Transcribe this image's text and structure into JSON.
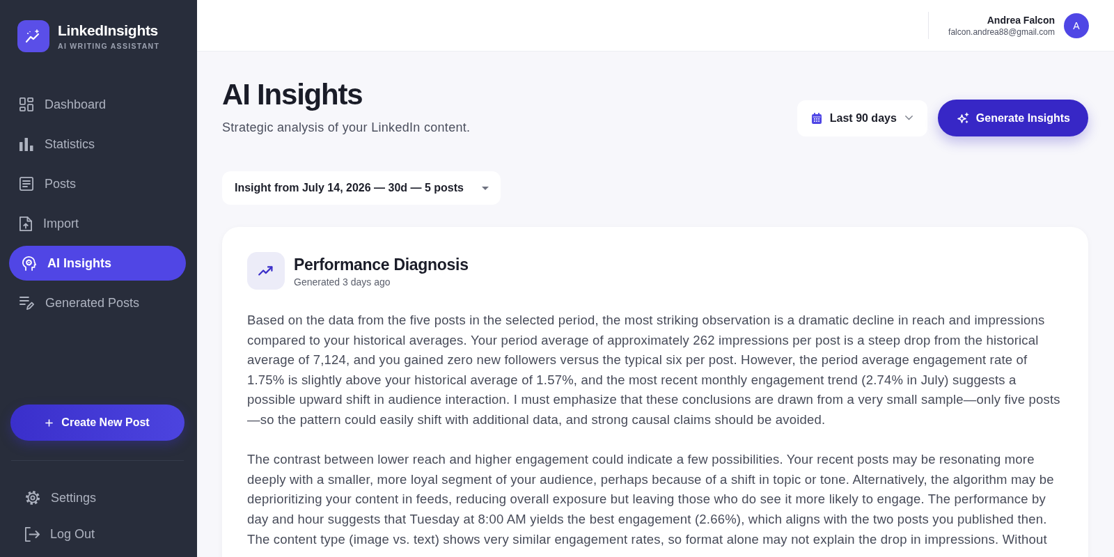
{
  "sidebar": {
    "brand": {
      "name": "LinkedInsights",
      "tagline": "AI WRITING ASSISTANT"
    },
    "nav": [
      {
        "label": "Dashboard",
        "kind": "dashboard",
        "selected": false
      },
      {
        "label": "Statistics",
        "kind": "statistics",
        "selected": false
      },
      {
        "label": "Posts",
        "kind": "posts",
        "selected": false
      },
      {
        "label": "Import",
        "kind": "import",
        "selected": false
      },
      {
        "label": "AI Insights",
        "kind": "insights",
        "selected": true
      },
      {
        "label": "Generated Posts",
        "kind": "generated",
        "selected": false
      }
    ],
    "create_button": "Create New Post",
    "footer_items": [
      {
        "label": "Settings",
        "kind": "settings"
      },
      {
        "label": "Log Out",
        "kind": "logout"
      }
    ]
  },
  "header": {
    "user": {
      "name": "Andrea Falcon",
      "email": "falcon.andrea88@gmail.com",
      "initial": "A"
    }
  },
  "page": {
    "title": "AI Insights",
    "subtitle": "Strategic analysis of your LinkedIn content.",
    "range_select": {
      "value": "Last 90 days"
    },
    "generate_button": "Generate Insights",
    "insight_select": {
      "value": "Insight from July 14, 2026 — 30d — 5 posts"
    }
  },
  "card": {
    "title": "Performance Diagnosis",
    "meta": "Generated 3 days ago",
    "paragraphs": [
      "Based on the data from the five posts in the selected period, the most striking observation is a dramatic decline in reach and impressions compared to your historical averages. Your period average of approximately 262 impressions per post is a steep drop from the historical average of 7,124, and you gained zero new followers versus the typical six per post. However, the period average engagement rate of 1.75% is slightly above your historical average of 1.57%, and the most recent monthly engagement trend (2.74% in July) suggests a possible upward shift in audience interaction. I must emphasize that these conclusions are drawn from a very small sample—only five posts—so the pattern could easily shift with additional data, and strong causal claims should be avoided.",
      "The contrast between lower reach and higher engagement could indicate a few possibilities. Your recent posts may be resonating more deeply with a smaller, more loyal segment of your audience, perhaps because of a shift in topic or tone. Alternatively, the algorithm may be deprioritizing your content in feeds, reducing overall exposure but leaving those who do see it more likely to engage. The performance by day and hour suggests that Tuesday at 8:00 AM yields the best engagement (2.66%), which aligns with the two posts you published then. The content type (image vs. text) shows very similar engagement rates, so format alone may not explain the drop in impressions. Without"
    ]
  }
}
